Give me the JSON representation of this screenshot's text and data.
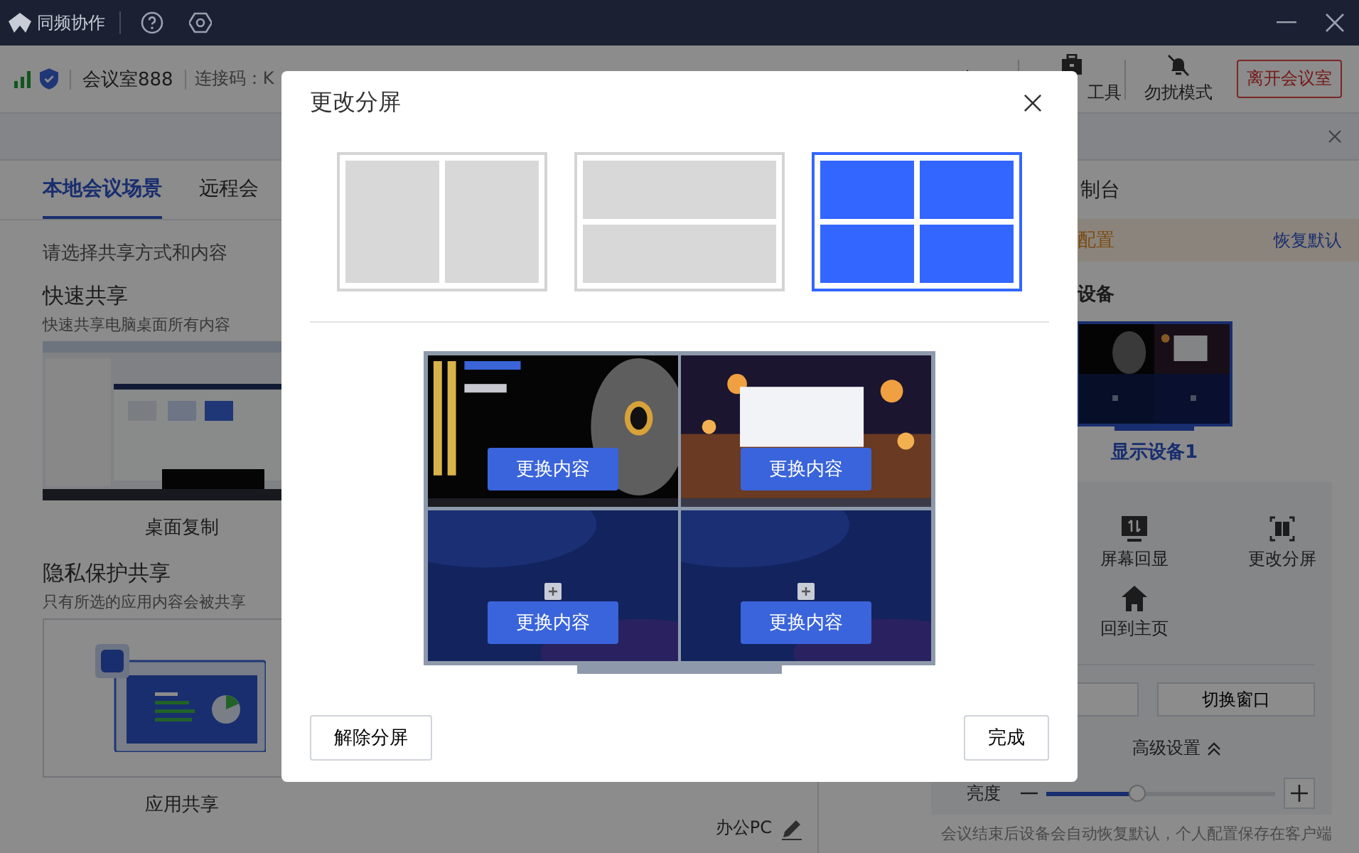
{
  "title_bar": {
    "app_name": "同频协作"
  },
  "toolbar": {
    "room": "会议室888",
    "connection_code": "连接码：K",
    "tools": [
      {
        "kind": "speaker"
      },
      {
        "kind": "toolbox",
        "label": "工具"
      },
      {
        "kind": "mute",
        "label": "勿扰模式"
      }
    ],
    "leave_button": "离开会议室"
  },
  "left_panel": {
    "tabs": [
      {
        "label": "本地会议场景",
        "selected": true
      },
      {
        "label": "远程会",
        "selected": false
      }
    ],
    "prompt": "请选择共享方式和内容",
    "sections": [
      {
        "kind": "desktop",
        "title": "快速共享",
        "description": "快速共享电脑桌面所有内容",
        "option": "桌面复制"
      },
      {
        "kind": "app",
        "title": "隐私保护共享",
        "description": "只有所选的应用内容会被共享",
        "option": "应用共享"
      }
    ],
    "device": "办公PC"
  },
  "right_panel": {
    "tab": "制台",
    "notice": "配置",
    "restore_link": "恢复默认",
    "section_title": "设备",
    "display": "显示设备1",
    "actions": [
      {
        "kind": "echo",
        "label": "屏幕回显"
      },
      {
        "kind": "split",
        "label": "更改分屏"
      },
      {
        "kind": "home",
        "label": "回到主页"
      }
    ],
    "switch_button": "切换窗口",
    "advanced": "高级设置",
    "brightness": {
      "label": "亮度",
      "level": 0.4
    },
    "footer": "会议结束后设备会自动恢复默认，个人配置保存在客户端"
  },
  "dialog": {
    "title": "更改分屏",
    "layouts": [
      {
        "kind": "columns",
        "selected": false
      },
      {
        "kind": "rows",
        "selected": false
      },
      {
        "kind": "grid",
        "selected": true
      }
    ],
    "screens": [
      {
        "kind": "desktop",
        "button": "更换内容"
      },
      {
        "kind": "lanterns",
        "button": "更换内容"
      },
      {
        "kind": "empty",
        "button": "更换内容"
      },
      {
        "kind": "empty",
        "button": "更换内容"
      }
    ],
    "clear_button": "解除分屏",
    "done_button": "完成"
  }
}
